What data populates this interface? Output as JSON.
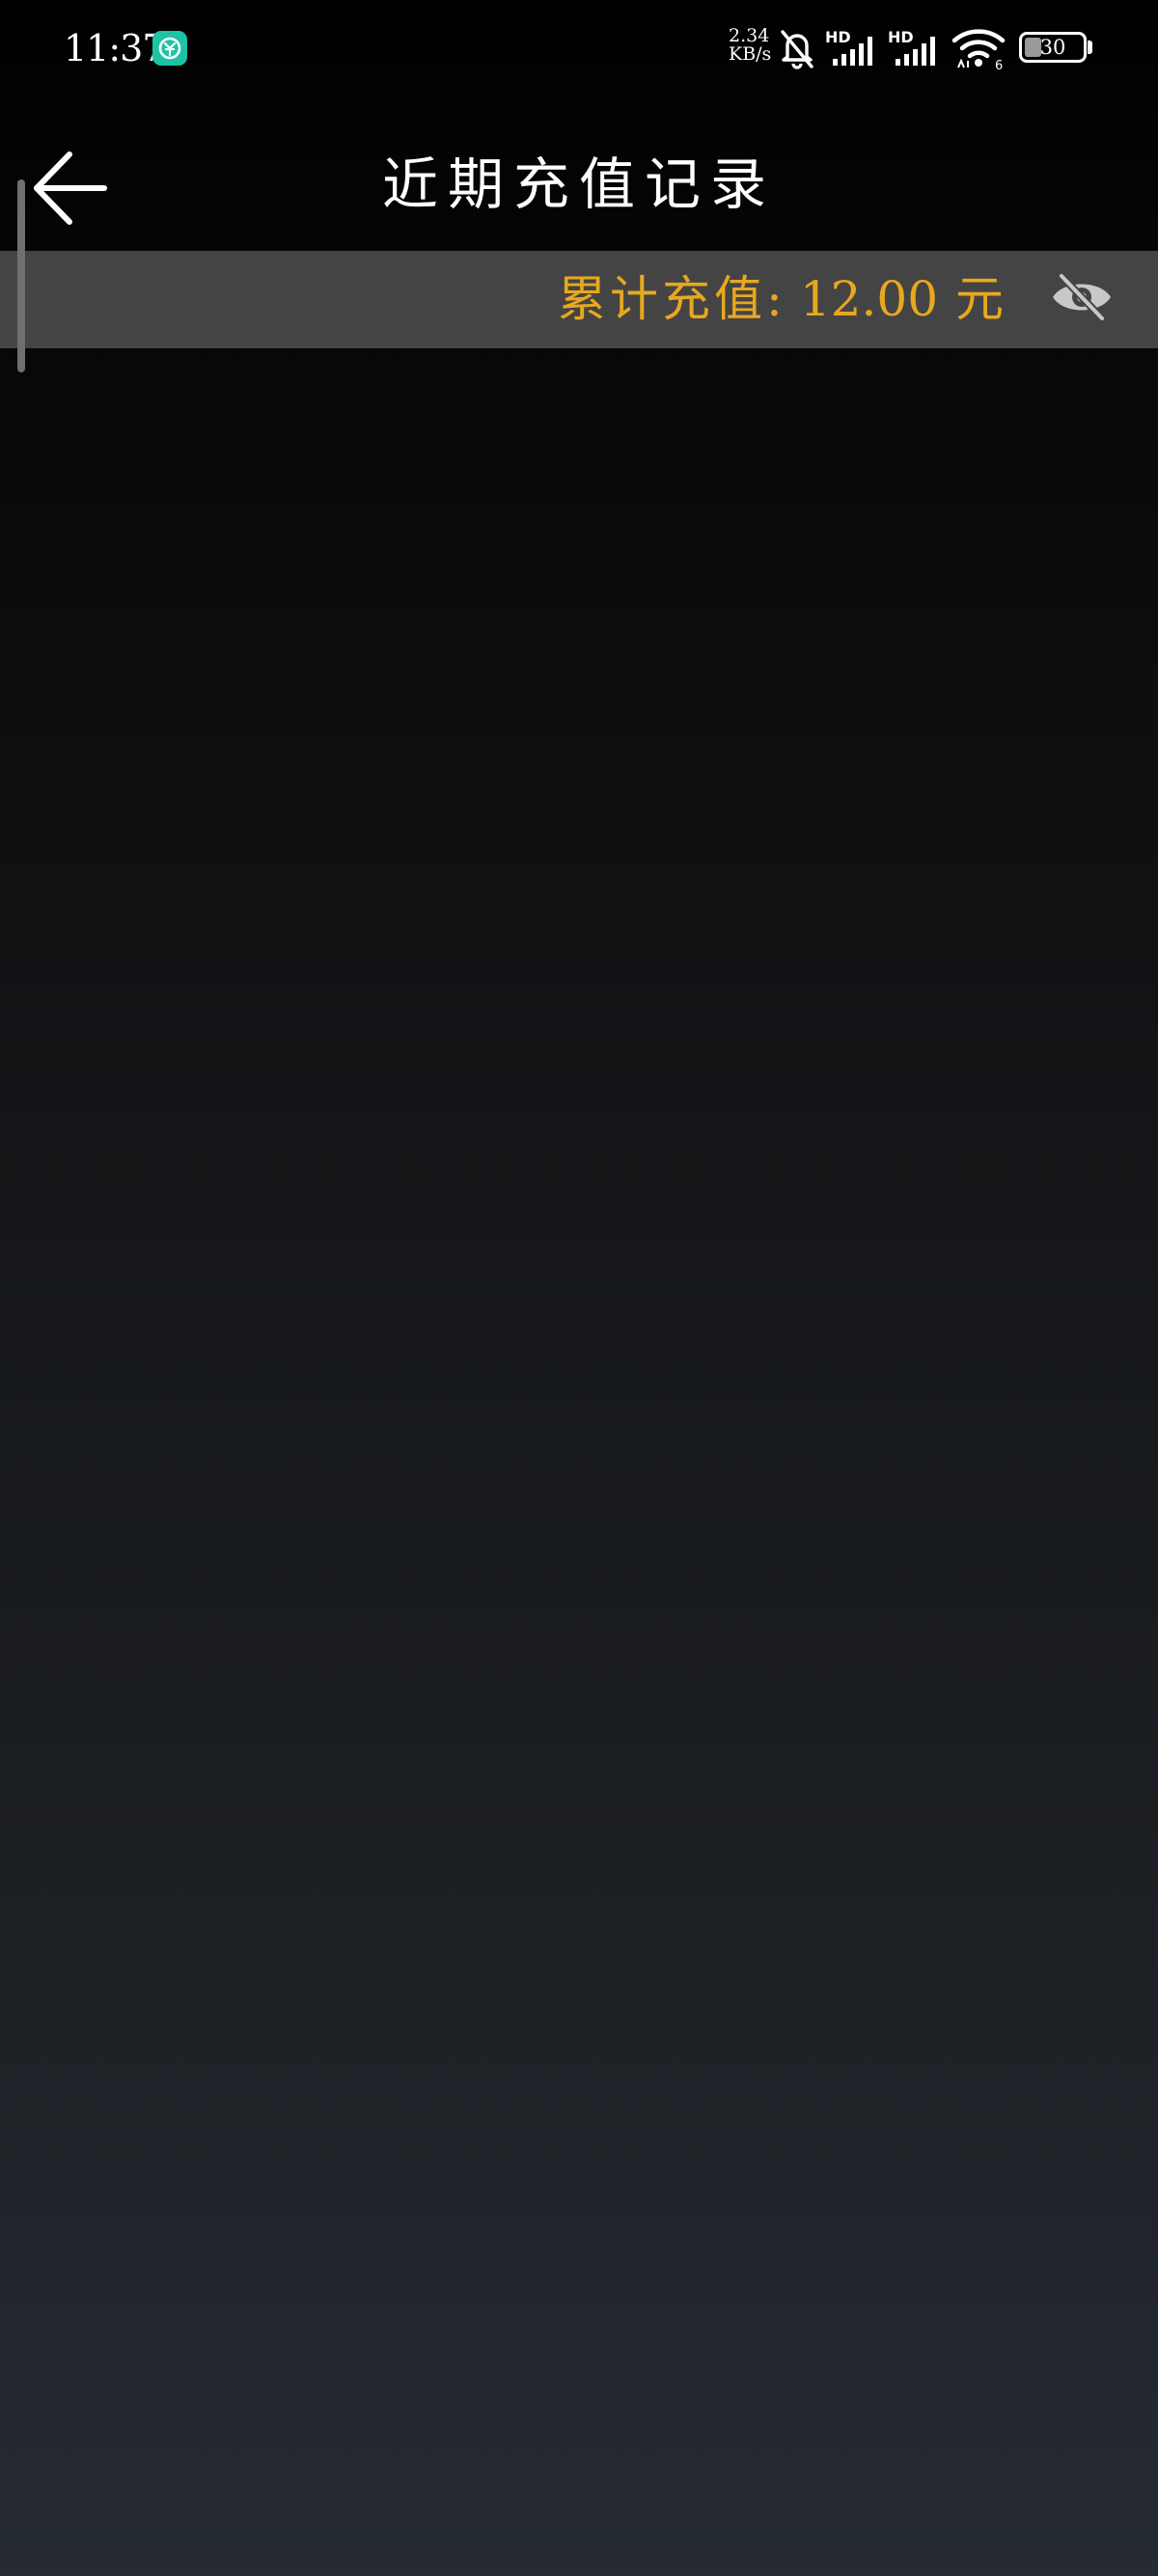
{
  "status_bar": {
    "time": "11:37",
    "net_speed_value": "2.34",
    "net_speed_unit": "KB/s",
    "signal_badge_1": "HD",
    "signal_badge_2": "HD",
    "wifi_badge": "6",
    "battery_level": "30",
    "battery_fraction": 0.3,
    "icons": [
      "app-notification-icon",
      "bell-muted-icon",
      "hd-signal-icon",
      "hd-signal-icon",
      "wifi-icon",
      "battery-icon"
    ]
  },
  "header": {
    "title": "近期充值记录",
    "back_icon": "arrow-left-icon"
  },
  "summary": {
    "label": "累计充值:",
    "amount": "12.00",
    "unit": "元",
    "toggle_icon": "eye-off-icon"
  },
  "records": [],
  "colors": {
    "accent_gold": "#e8a81e",
    "summary_bar_bg": "#444444",
    "app_icon_teal": "#1ec3a6",
    "background_top": "#000000",
    "background_bottom": "#252a33"
  }
}
